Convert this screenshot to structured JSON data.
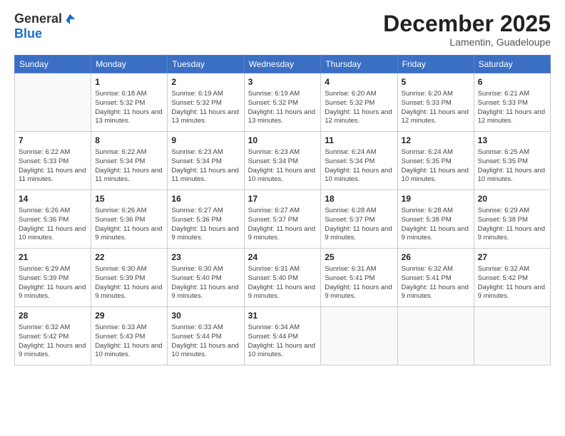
{
  "logo": {
    "general": "General",
    "blue": "Blue"
  },
  "title": "December 2025",
  "subtitle": "Lamentin, Guadeloupe",
  "days_header": [
    "Sunday",
    "Monday",
    "Tuesday",
    "Wednesday",
    "Thursday",
    "Friday",
    "Saturday"
  ],
  "weeks": [
    [
      {
        "day": "",
        "sunrise": "",
        "sunset": "",
        "daylight": ""
      },
      {
        "day": "1",
        "sunrise": "Sunrise: 6:18 AM",
        "sunset": "Sunset: 5:32 PM",
        "daylight": "Daylight: 11 hours and 13 minutes."
      },
      {
        "day": "2",
        "sunrise": "Sunrise: 6:19 AM",
        "sunset": "Sunset: 5:32 PM",
        "daylight": "Daylight: 11 hours and 13 minutes."
      },
      {
        "day": "3",
        "sunrise": "Sunrise: 6:19 AM",
        "sunset": "Sunset: 5:32 PM",
        "daylight": "Daylight: 11 hours and 13 minutes."
      },
      {
        "day": "4",
        "sunrise": "Sunrise: 6:20 AM",
        "sunset": "Sunset: 5:32 PM",
        "daylight": "Daylight: 11 hours and 12 minutes."
      },
      {
        "day": "5",
        "sunrise": "Sunrise: 6:20 AM",
        "sunset": "Sunset: 5:33 PM",
        "daylight": "Daylight: 11 hours and 12 minutes."
      },
      {
        "day": "6",
        "sunrise": "Sunrise: 6:21 AM",
        "sunset": "Sunset: 5:33 PM",
        "daylight": "Daylight: 11 hours and 12 minutes."
      }
    ],
    [
      {
        "day": "7",
        "sunrise": "Sunrise: 6:22 AM",
        "sunset": "Sunset: 5:33 PM",
        "daylight": "Daylight: 11 hours and 11 minutes."
      },
      {
        "day": "8",
        "sunrise": "Sunrise: 6:22 AM",
        "sunset": "Sunset: 5:34 PM",
        "daylight": "Daylight: 11 hours and 11 minutes."
      },
      {
        "day": "9",
        "sunrise": "Sunrise: 6:23 AM",
        "sunset": "Sunset: 5:34 PM",
        "daylight": "Daylight: 11 hours and 11 minutes."
      },
      {
        "day": "10",
        "sunrise": "Sunrise: 6:23 AM",
        "sunset": "Sunset: 5:34 PM",
        "daylight": "Daylight: 11 hours and 10 minutes."
      },
      {
        "day": "11",
        "sunrise": "Sunrise: 6:24 AM",
        "sunset": "Sunset: 5:34 PM",
        "daylight": "Daylight: 11 hours and 10 minutes."
      },
      {
        "day": "12",
        "sunrise": "Sunrise: 6:24 AM",
        "sunset": "Sunset: 5:35 PM",
        "daylight": "Daylight: 11 hours and 10 minutes."
      },
      {
        "day": "13",
        "sunrise": "Sunrise: 6:25 AM",
        "sunset": "Sunset: 5:35 PM",
        "daylight": "Daylight: 11 hours and 10 minutes."
      }
    ],
    [
      {
        "day": "14",
        "sunrise": "Sunrise: 6:26 AM",
        "sunset": "Sunset: 5:36 PM",
        "daylight": "Daylight: 11 hours and 10 minutes."
      },
      {
        "day": "15",
        "sunrise": "Sunrise: 6:26 AM",
        "sunset": "Sunset: 5:36 PM",
        "daylight": "Daylight: 11 hours and 9 minutes."
      },
      {
        "day": "16",
        "sunrise": "Sunrise: 6:27 AM",
        "sunset": "Sunset: 5:36 PM",
        "daylight": "Daylight: 11 hours and 9 minutes."
      },
      {
        "day": "17",
        "sunrise": "Sunrise: 6:27 AM",
        "sunset": "Sunset: 5:37 PM",
        "daylight": "Daylight: 11 hours and 9 minutes."
      },
      {
        "day": "18",
        "sunrise": "Sunrise: 6:28 AM",
        "sunset": "Sunset: 5:37 PM",
        "daylight": "Daylight: 11 hours and 9 minutes."
      },
      {
        "day": "19",
        "sunrise": "Sunrise: 6:28 AM",
        "sunset": "Sunset: 5:38 PM",
        "daylight": "Daylight: 11 hours and 9 minutes."
      },
      {
        "day": "20",
        "sunrise": "Sunrise: 6:29 AM",
        "sunset": "Sunset: 5:38 PM",
        "daylight": "Daylight: 11 hours and 9 minutes."
      }
    ],
    [
      {
        "day": "21",
        "sunrise": "Sunrise: 6:29 AM",
        "sunset": "Sunset: 5:39 PM",
        "daylight": "Daylight: 11 hours and 9 minutes."
      },
      {
        "day": "22",
        "sunrise": "Sunrise: 6:30 AM",
        "sunset": "Sunset: 5:39 PM",
        "daylight": "Daylight: 11 hours and 9 minutes."
      },
      {
        "day": "23",
        "sunrise": "Sunrise: 6:30 AM",
        "sunset": "Sunset: 5:40 PM",
        "daylight": "Daylight: 11 hours and 9 minutes."
      },
      {
        "day": "24",
        "sunrise": "Sunrise: 6:31 AM",
        "sunset": "Sunset: 5:40 PM",
        "daylight": "Daylight: 11 hours and 9 minutes."
      },
      {
        "day": "25",
        "sunrise": "Sunrise: 6:31 AM",
        "sunset": "Sunset: 5:41 PM",
        "daylight": "Daylight: 11 hours and 9 minutes."
      },
      {
        "day": "26",
        "sunrise": "Sunrise: 6:32 AM",
        "sunset": "Sunset: 5:41 PM",
        "daylight": "Daylight: 11 hours and 9 minutes."
      },
      {
        "day": "27",
        "sunrise": "Sunrise: 6:32 AM",
        "sunset": "Sunset: 5:42 PM",
        "daylight": "Daylight: 11 hours and 9 minutes."
      }
    ],
    [
      {
        "day": "28",
        "sunrise": "Sunrise: 6:32 AM",
        "sunset": "Sunset: 5:42 PM",
        "daylight": "Daylight: 11 hours and 9 minutes."
      },
      {
        "day": "29",
        "sunrise": "Sunrise: 6:33 AM",
        "sunset": "Sunset: 5:43 PM",
        "daylight": "Daylight: 11 hours and 10 minutes."
      },
      {
        "day": "30",
        "sunrise": "Sunrise: 6:33 AM",
        "sunset": "Sunset: 5:44 PM",
        "daylight": "Daylight: 11 hours and 10 minutes."
      },
      {
        "day": "31",
        "sunrise": "Sunrise: 6:34 AM",
        "sunset": "Sunset: 5:44 PM",
        "daylight": "Daylight: 11 hours and 10 minutes."
      },
      {
        "day": "",
        "sunrise": "",
        "sunset": "",
        "daylight": ""
      },
      {
        "day": "",
        "sunrise": "",
        "sunset": "",
        "daylight": ""
      },
      {
        "day": "",
        "sunrise": "",
        "sunset": "",
        "daylight": ""
      }
    ]
  ]
}
